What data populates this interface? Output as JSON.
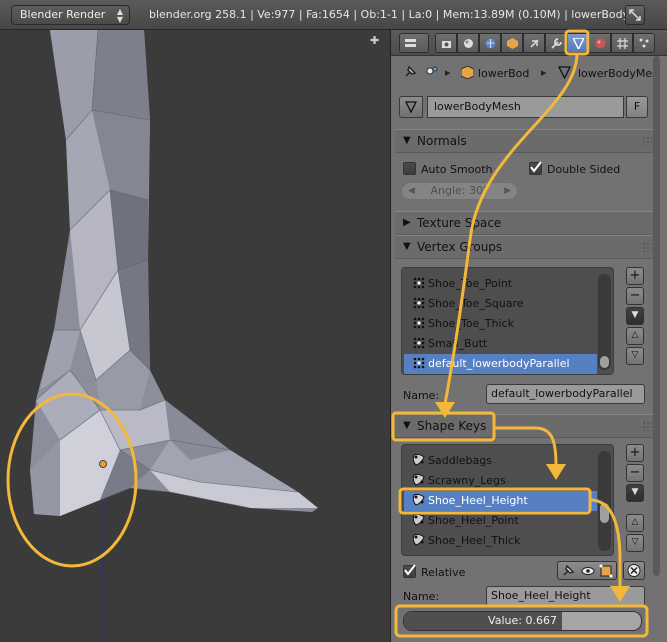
{
  "topbar": {
    "engine": "Blender Render",
    "stats": "blender.org 258.1 | Ve:977 | Fa:1654 | Ob:1-1 | La:0 | Mem:13.89M (0.10M) | lowerBody"
  },
  "breadcrumb": {
    "object": "lowerBod",
    "mesh": "lowerBodyMes"
  },
  "mesh": {
    "name": "lowerBodyMesh",
    "fake_user": "F"
  },
  "normals": {
    "title": "Normals",
    "auto_smooth": {
      "label": "Auto Smooth",
      "checked": false
    },
    "double_sided": {
      "label": "Double Sided",
      "checked": true
    },
    "angle": "Angle: 30°"
  },
  "texture_space": {
    "title": "Texture Space"
  },
  "vertex_groups": {
    "title": "Vertex Groups",
    "items": [
      "Shoe_Toe_Point",
      "Shoe_Toe_Square",
      "Shoe_Toe_Thick",
      "Small_Butt",
      "default_lowerbodyParallel"
    ],
    "selected_index": 4,
    "name_label": "Name:",
    "name_value": "default_lowerbodyParallel"
  },
  "shape_keys": {
    "title": "Shape Keys",
    "items": [
      "Saddlebags",
      "Scrawny_Legs",
      "Shoe_Heel_Height",
      "Shoe_Heel_Point",
      "Shoe_Heel_Thick"
    ],
    "selected_index": 2,
    "relative": {
      "label": "Relative",
      "checked": true
    },
    "name_label": "Name:",
    "name_value": "Shoe_Heel_Height",
    "value_text": "Value: 0.667",
    "value": 0.667
  },
  "colors": {
    "highlight": "#f3b83a",
    "selection": "#5680c2",
    "panel_bg": "#727272",
    "viewport_bg": "#3b3b3b"
  }
}
